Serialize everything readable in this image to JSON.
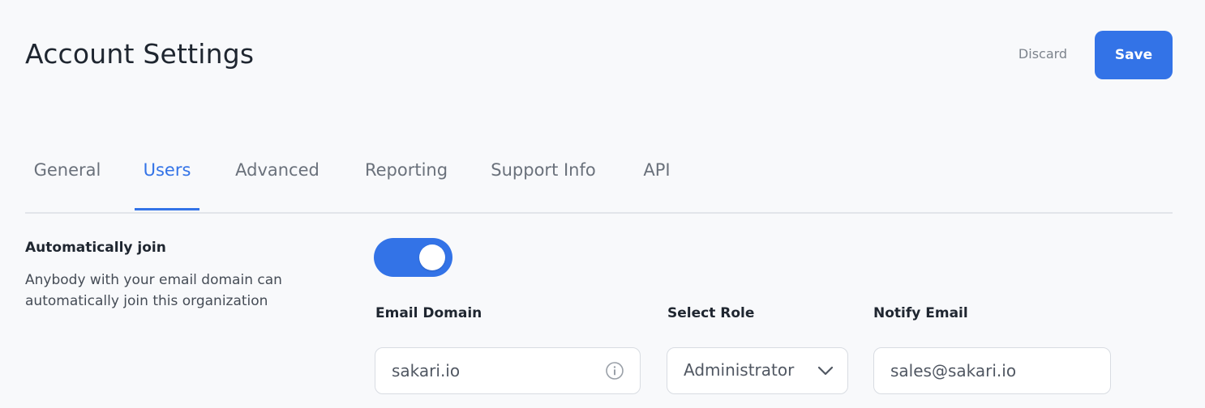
{
  "header": {
    "title": "Account Settings",
    "discard_label": "Discard",
    "save_label": "Save"
  },
  "tabs": [
    {
      "label": "General",
      "active": false
    },
    {
      "label": "Users",
      "active": true
    },
    {
      "label": "Advanced",
      "active": false
    },
    {
      "label": "Reporting",
      "active": false
    },
    {
      "label": "Support Info",
      "active": false
    },
    {
      "label": "API",
      "active": false
    }
  ],
  "auto_join": {
    "label": "Automatically join",
    "description": "Anybody with your email domain can automatically join this organization",
    "enabled": true
  },
  "fields": {
    "email_domain": {
      "label": "Email Domain",
      "value": "sakari.io",
      "icon": "info-icon"
    },
    "select_role": {
      "label": "Select Role",
      "value": "Administrator",
      "icon": "chevron-down-icon"
    },
    "notify_email": {
      "label": "Notify Email",
      "value": "sales@sakari.io"
    }
  },
  "colors": {
    "accent": "#3373e7",
    "background": "#f8f9fb",
    "divider": "#e2e5ea",
    "muted_text": "#6a717b"
  }
}
